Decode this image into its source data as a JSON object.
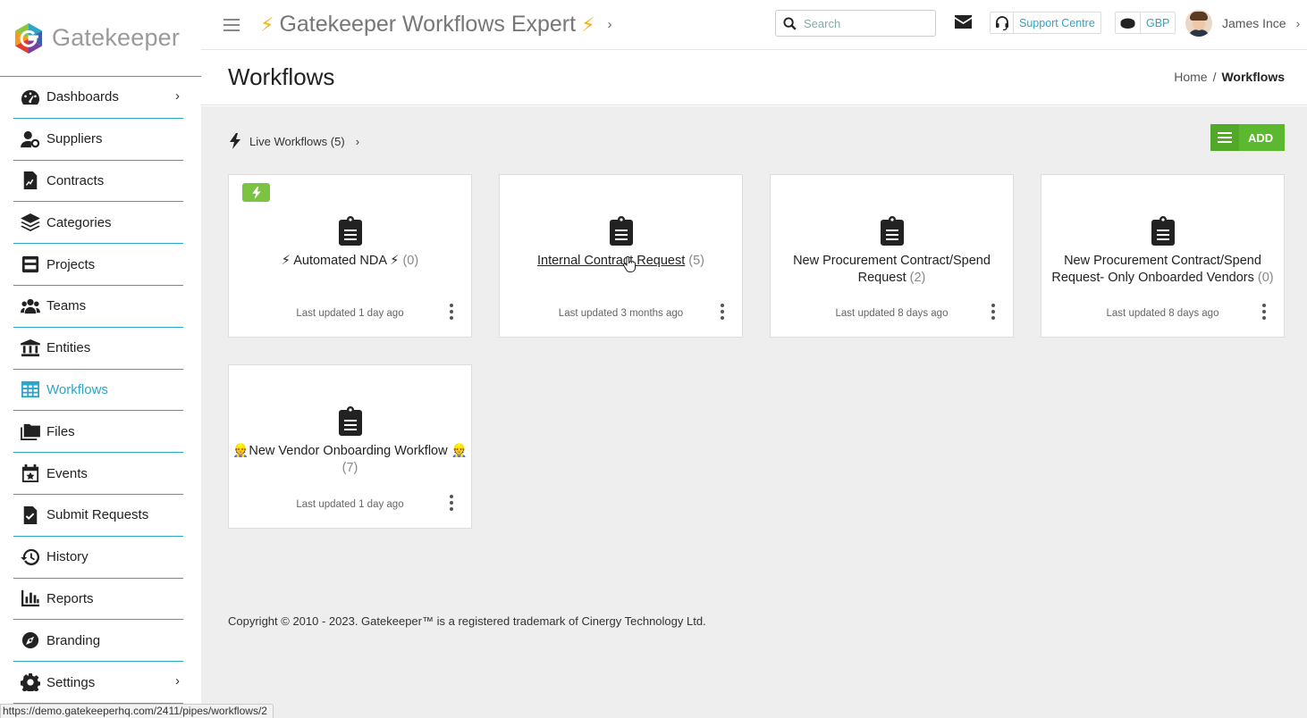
{
  "brand": {
    "name": "Gatekeeper"
  },
  "topbar": {
    "app_title": "Gatekeeper Workflows Expert",
    "search_placeholder": "Search",
    "support_label": "Support Centre",
    "currency": "GBP",
    "user_name": "James Ince"
  },
  "sidebar": {
    "items": [
      {
        "label": "Dashboards",
        "icon": "dashboard-icon"
      },
      {
        "label": "Suppliers",
        "icon": "user-cog-icon"
      },
      {
        "label": "Contracts",
        "icon": "file-contract-icon"
      },
      {
        "label": "Categories",
        "icon": "layers-icon"
      },
      {
        "label": "Projects",
        "icon": "projects-icon"
      },
      {
        "label": "Teams",
        "icon": "users-icon"
      },
      {
        "label": "Entities",
        "icon": "bank-icon"
      },
      {
        "label": "Workflows",
        "icon": "table-icon"
      },
      {
        "label": "Files",
        "icon": "folders-icon"
      },
      {
        "label": "Events",
        "icon": "calendar-star-icon"
      },
      {
        "label": "Submit Requests",
        "icon": "file-check-icon"
      },
      {
        "label": "History",
        "icon": "history-icon"
      },
      {
        "label": "Reports",
        "icon": "bar-chart-icon"
      },
      {
        "label": "Branding",
        "icon": "compass-icon"
      },
      {
        "label": "Settings",
        "icon": "gear-icon"
      }
    ]
  },
  "page": {
    "title": "Workflows",
    "breadcrumb_home": "Home",
    "breadcrumb_sep": "/",
    "breadcrumb_current": "Workflows"
  },
  "section": {
    "label": "Live Workflows (5)",
    "add_label": "ADD"
  },
  "workflows": [
    {
      "prefix": "⚡ ",
      "name": "Automated NDA",
      "suffix": " ⚡",
      "count": "(0)",
      "updated": "Last updated 1 day ago"
    },
    {
      "prefix": "",
      "name": "Internal Contract Request",
      "suffix": "",
      "count": "(5)",
      "updated": "Last updated 3 months ago"
    },
    {
      "prefix": "",
      "name": "New Procurement Contract/Spend Request",
      "suffix": "",
      "count": "(2)",
      "updated": "Last updated 8 days ago"
    },
    {
      "prefix": "",
      "name": "New Procurement Contract/Spend Request- Only Onboarded Vendors",
      "suffix": "",
      "count": "(0)",
      "updated": "Last updated 8 days ago"
    },
    {
      "prefix": "👷",
      "name": "New Vendor Onboarding Workflow",
      "suffix": " 👷",
      "count": "(7)",
      "updated": "Last updated 1 day ago"
    }
  ],
  "footer": {
    "copyright": "Copyright © 2010 - 2023. Gatekeeper™ is a registered trademark of Cinergy Technology Ltd."
  },
  "status_url": "https://demo.gatekeeperhq.com/2411/pipes/workflows/2",
  "colors": {
    "accent": "#2aa6c9",
    "add_green": "#5cb82e",
    "bolt": "#f3b31b"
  }
}
